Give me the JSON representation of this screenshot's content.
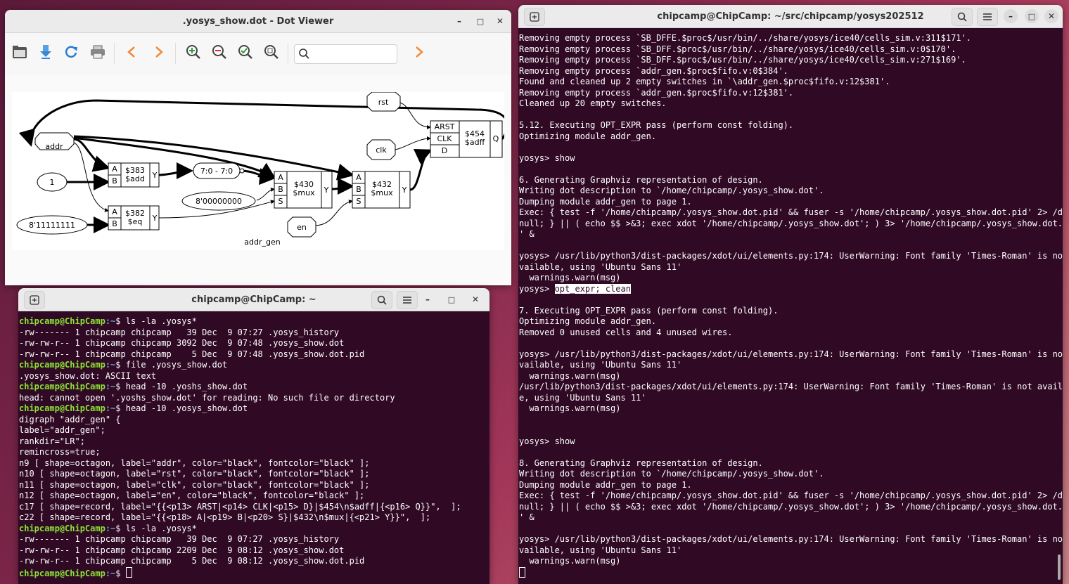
{
  "dot_viewer": {
    "title": ".yosys_show.dot - Dot Viewer",
    "toolbar_icons": [
      "open-icon",
      "download-icon",
      "refresh-icon",
      "print-icon",
      "back-icon",
      "forward-icon",
      "zoom-in-icon",
      "zoom-out-icon",
      "zoom-fit-icon",
      "zoom-100-icon",
      "find-icon",
      "find-next-icon"
    ],
    "graph": {
      "label": "addr_gen",
      "nodes": {
        "rst": "rst",
        "clk": "clk",
        "addr": "addr",
        "en": "en",
        "one": "1",
        "eight_ones": "8'11111111",
        "zeros": "8'00000000",
        "slice": "7:0 - 7:0",
        "add_a": "A",
        "add_b": "B",
        "add_name": "$383",
        "add_type": "$add",
        "add_y": "Y",
        "eq_a": "A",
        "eq_b": "B",
        "eq_name": "$382",
        "eq_type": "$eq",
        "eq_y": "Y",
        "mux1_a": "A",
        "mux1_b": "B",
        "mux1_s": "S",
        "mux1_name": "$430",
        "mux1_type": "$mux",
        "mux1_y": "Y",
        "mux2_a": "A",
        "mux2_b": "B",
        "mux2_s": "S",
        "mux2_name": "$432",
        "mux2_type": "$mux",
        "mux2_y": "Y",
        "ff_arst": "ARST",
        "ff_clk": "CLK",
        "ff_d": "D",
        "ff_name": "$454",
        "ff_type": "$adff",
        "ff_q": "Q"
      }
    }
  },
  "terminal_right": {
    "title": "chipcamp@ChipCamp: ~/src/chipcamp/yosys202512",
    "lines": [
      "Removing empty process `SB_DFFE.$proc$/usr/bin/../share/yosys/ice40/cells_sim.v:311$171'.",
      "Removing empty process `SB_DFF.$proc$/usr/bin/../share/yosys/ice40/cells_sim.v:0$170'.",
      "Removing empty process `SB_DFF.$proc$/usr/bin/../share/yosys/ice40/cells_sim.v:271$169'.",
      "Removing empty process `addr_gen.$proc$fifo.v:0$384'.",
      "Found and cleaned up 2 empty switches in `\\addr_gen.$proc$fifo.v:12$381'.",
      "Removing empty process `addr_gen.$proc$fifo.v:12$381'.",
      "Cleaned up 20 empty switches.",
      "",
      "5.12. Executing OPT_EXPR pass (perform const folding).",
      "Optimizing module addr_gen.",
      "",
      "yosys> show",
      "",
      "6. Generating Graphviz representation of design.",
      "Writing dot description to `/home/chipcamp/.yosys_show.dot'.",
      "Dumping module addr_gen to page 1.",
      "Exec: { test -f '/home/chipcamp/.yosys_show.dot.pid' && fuser -s '/home/chipcamp/.yosys_show.dot.pid' 2> /dev/",
      "null; } || ( echo $$ >&3; exec xdot '/home/chipcamp/.yosys_show.dot'; ) 3> '/home/chipcamp/.yosys_show.dot.pid",
      "' &",
      "",
      "yosys> /usr/lib/python3/dist-packages/xdot/ui/elements.py:174: UserWarning: Font family 'Times-Roman' is not a",
      "vailable, using 'Ubuntu Sans 11'",
      "  warnings.warn(msg)",
      "__PROMPT_SEL__",
      "",
      "7. Executing OPT_EXPR pass (perform const folding).",
      "Optimizing module addr_gen.",
      "Removed 0 unused cells and 4 unused wires.",
      "",
      "yosys> /usr/lib/python3/dist-packages/xdot/ui/elements.py:174: UserWarning: Font family 'Times-Roman' is not a",
      "vailable, using 'Ubuntu Sans 11'",
      "  warnings.warn(msg)",
      "/usr/lib/python3/dist-packages/xdot/ui/elements.py:174: UserWarning: Font family 'Times-Roman' is not availabl",
      "e, using 'Ubuntu Sans 11'",
      "  warnings.warn(msg)",
      "",
      "",
      "yosys> show",
      "",
      "8. Generating Graphviz representation of design.",
      "Writing dot description to `/home/chipcamp/.yosys_show.dot'.",
      "Dumping module addr_gen to page 1.",
      "Exec: { test -f '/home/chipcamp/.yosys_show.dot.pid' && fuser -s '/home/chipcamp/.yosys_show.dot.pid' 2> /dev/",
      "null; } || ( echo $$ >&3; exec xdot '/home/chipcamp/.yosys_show.dot'; ) 3> '/home/chipcamp/.yosys_show.dot.pid",
      "' &",
      "",
      "yosys> /usr/lib/python3/dist-packages/xdot/ui/elements.py:174: UserWarning: Font family 'Times-Roman' is not a",
      "vailable, using 'Ubuntu Sans 11'",
      "  warnings.warn(msg)",
      "__CURSOR__"
    ],
    "selected_prompt": "yosys> ",
    "selected_text": "opt_expr; clean"
  },
  "terminal_left": {
    "title": "chipcamp@ChipCamp: ~",
    "prompt_user": "chipcamp@ChipCamp",
    "prompt_path": ":~",
    "prompt_suffix": "$ ",
    "lines": [
      {
        "p": true,
        "t": "ls -la .yosys*"
      },
      {
        "p": false,
        "t": "-rw------- 1 chipcamp chipcamp   39 Dec  9 07:27 .yosys_history"
      },
      {
        "p": false,
        "t": "-rw-rw-r-- 1 chipcamp chipcamp 3092 Dec  9 07:48 .yosys_show.dot"
      },
      {
        "p": false,
        "t": "-rw-rw-r-- 1 chipcamp chipcamp    5 Dec  9 07:48 .yosys_show.dot.pid"
      },
      {
        "p": true,
        "t": "file .yosys_show.dot"
      },
      {
        "p": false,
        "t": ".yosys_show.dot: ASCII text"
      },
      {
        "p": true,
        "t": "head -10 .yoshs_show.dot"
      },
      {
        "p": false,
        "t": "head: cannot open '.yoshs_show.dot' for reading: No such file or directory"
      },
      {
        "p": true,
        "t": "head -10 .yosys_show.dot"
      },
      {
        "p": false,
        "t": "digraph \"addr_gen\" {"
      },
      {
        "p": false,
        "t": "label=\"addr_gen\";"
      },
      {
        "p": false,
        "t": "rankdir=\"LR\";"
      },
      {
        "p": false,
        "t": "remincross=true;"
      },
      {
        "p": false,
        "t": "n9 [ shape=octagon, label=\"addr\", color=\"black\", fontcolor=\"black\" ];"
      },
      {
        "p": false,
        "t": "n10 [ shape=octagon, label=\"rst\", color=\"black\", fontcolor=\"black\" ];"
      },
      {
        "p": false,
        "t": "n11 [ shape=octagon, label=\"clk\", color=\"black\", fontcolor=\"black\" ];"
      },
      {
        "p": false,
        "t": "n12 [ shape=octagon, label=\"en\", color=\"black\", fontcolor=\"black\" ];"
      },
      {
        "p": false,
        "t": "c17 [ shape=record, label=\"{{<p13> ARST|<p14> CLK|<p15> D}|$454\\n$adff|{<p16> Q}}\",  ];"
      },
      {
        "p": false,
        "t": "c22 [ shape=record, label=\"{{<p18> A|<p19> B|<p20> S}|$432\\n$mux|{<p21> Y}}\",  ];"
      },
      {
        "p": true,
        "t": "ls -la .yosys*"
      },
      {
        "p": false,
        "t": "-rw------- 1 chipcamp chipcamp   39 Dec  9 07:27 .yosys_history"
      },
      {
        "p": false,
        "t": "-rw-rw-r-- 1 chipcamp chipcamp 2209 Dec  9 08:12 .yosys_show.dot"
      },
      {
        "p": false,
        "t": "-rw-rw-r-- 1 chipcamp chipcamp    5 Dec  9 08:12 .yosys_show.dot.pid"
      },
      {
        "p": true,
        "t": "",
        "cursor": true
      }
    ]
  },
  "window_controls": {
    "minimize": "–",
    "maximize": "□",
    "close": "✕",
    "new_tab": "⊞",
    "search": "⌕",
    "menu": "≡"
  }
}
